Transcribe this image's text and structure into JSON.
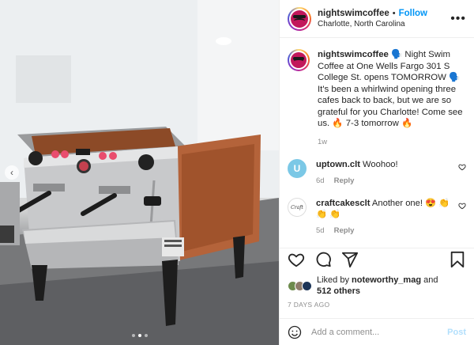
{
  "header": {
    "username": "nightswimcoffee",
    "separator": "•",
    "follow_label": "Follow",
    "location": "Charlotte, North Carolina",
    "more_icon": "more-horizontal-icon",
    "more_glyph": "•••"
  },
  "caption": {
    "username": "nightswimcoffee",
    "text": " 🗣️ Night Swim Coffee at One Wells Fargo 301 S College St. opens TOMORROW 🗣️ It's been a whirlwind opening three cafes back to back, but we are so grateful for you Charlotte! Come see us. 🔥 7-3 tomorrow 🔥",
    "time": "1w"
  },
  "comments": [
    {
      "username": "uptown.clt",
      "text": " Woohoo!",
      "avatar_glyph": "U",
      "time": "6d",
      "reply_label": "Reply"
    },
    {
      "username": "craftcakesclt",
      "text": " Another one! 😍 👏 👏 👏",
      "avatar_glyph": "Craft",
      "time": "5d",
      "reply_label": "Reply"
    }
  ],
  "actions": {
    "like_icon": "heart-icon",
    "comment_icon": "comment-icon",
    "share_icon": "share-icon",
    "save_icon": "bookmark-icon"
  },
  "likes": {
    "prefix": "Liked by ",
    "user": "noteworthy_mag",
    "middle": " and",
    "others": "512 others"
  },
  "posted_ago": "7 DAYS AGO",
  "add_comment": {
    "placeholder": "Add a comment...",
    "post_label": "Post"
  },
  "carousel": {
    "prev_glyph": "‹",
    "slide_count": 3,
    "active_slide": 2
  },
  "colors": {
    "accent_blue": "#0095f6",
    "post_disabled": "#b2dffc",
    "machine_copper": "#b4633a"
  }
}
